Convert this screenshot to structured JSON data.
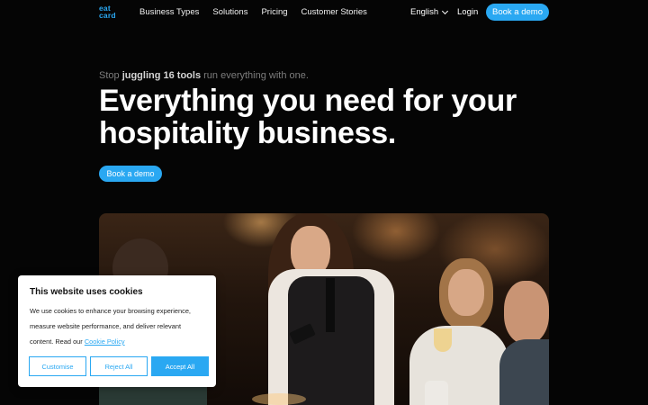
{
  "nav": {
    "logo_line1": "eat",
    "logo_line2": "card",
    "links": [
      "Business Types",
      "Solutions",
      "Pricing",
      "Customer Stories"
    ],
    "language": "English",
    "login": "Login",
    "cta": "Book a demo"
  },
  "hero": {
    "tagline_start": "Stop ",
    "tagline_bold": "juggling 16 tools",
    "tagline_end": " run everything with one.",
    "headline_line1": "Everything you need for your",
    "headline_line2": "hospitality business.",
    "cta": "Book a demo"
  },
  "cookie": {
    "title": "This website uses cookies",
    "body": "We use cookies to enhance your browsing experience, measure website performance, and deliver relevant content. Read our ",
    "link": "Cookie Policy",
    "customise": "Customise",
    "reject": "Reject All",
    "accept": "Accept All"
  },
  "colors": {
    "accent": "#2aa8f2",
    "background": "#050505"
  }
}
